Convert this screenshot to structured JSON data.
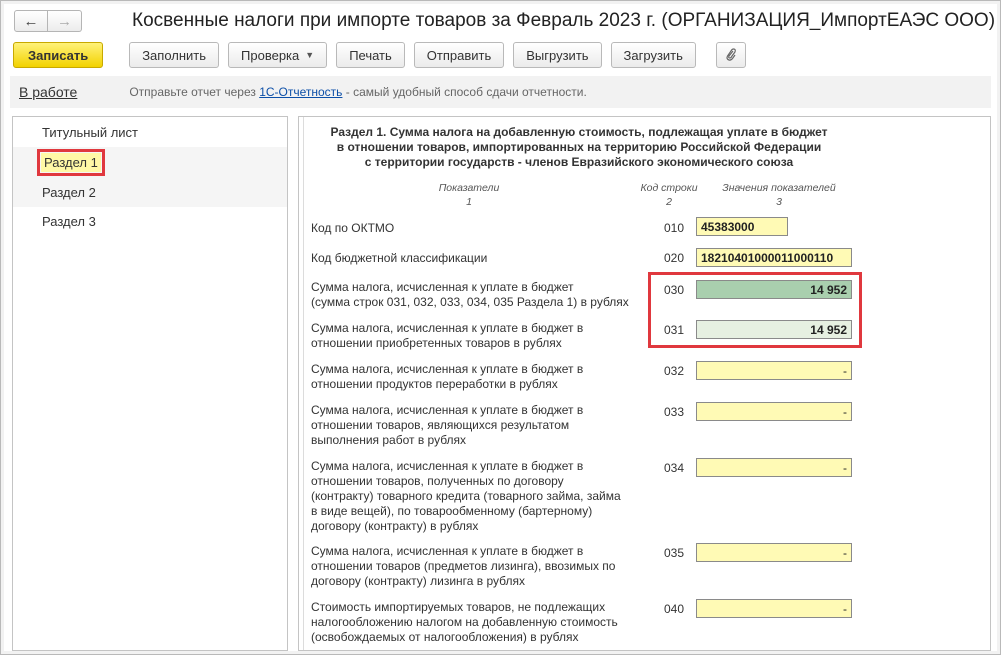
{
  "window": {
    "title": "Косвенные налоги при импорте товаров за Февраль 2023 г. (ОРГАНИЗАЦИЯ_ИмпортЕАЭС ООО)",
    "back_icon": "arrow-left-icon",
    "forward_icon": "arrow-right-icon"
  },
  "toolbar": {
    "save_label": "Записать",
    "fill_label": "Заполнить",
    "check_label": "Проверка",
    "print_label": "Печать",
    "send_label": "Отправить",
    "export_label": "Выгрузить",
    "import_label": "Загрузить",
    "attach_icon": "paperclip-icon"
  },
  "status": {
    "state_label": "В работе",
    "message_before": "Отправьте отчет через ",
    "message_link": "1С-Отчетность",
    "message_after": " - самый удобный способ сдачи отчетности."
  },
  "sidebar": {
    "items": [
      {
        "label": "Титульный лист"
      },
      {
        "label": "Раздел 1"
      },
      {
        "label": "Раздел 2"
      },
      {
        "label": "Раздел 3"
      }
    ]
  },
  "section": {
    "heading_line1": "Раздел 1. Сумма налога на добавленную стоимость, подлежащая уплате в бюджет",
    "heading_line2": "в отношении товаров, импортированных на территорию Российской Федерации",
    "heading_line3": "с территории государств - членов Евразийского экономического союза",
    "col1_title": "Показатели",
    "col1_num": "1",
    "col2_title": "Код строки",
    "col2_num": "2",
    "col3_title": "Значения показателей",
    "col3_num": "3",
    "rows": [
      {
        "label": "Код по ОКТМО",
        "code": "010",
        "value": "45383000"
      },
      {
        "label": "Код бюджетной классификации",
        "code": "020",
        "value": "18210401000011000110"
      },
      {
        "label1": "Сумма налога, исчисленная к уплате в бюджет",
        "label2": "(сумма строк 031, 032, 033, 034, 035 Раздела 1) в рублях",
        "code": "030",
        "value": "14 952"
      },
      {
        "label1": "Сумма налога, исчисленная к уплате в бюджет в",
        "label2": "отношении приобретенных товаров в рублях",
        "code": "031",
        "value": "14 952"
      },
      {
        "label1": "Сумма налога, исчисленная к уплате в бюджет в",
        "label2": "отношении продуктов переработки в рублях",
        "code": "032",
        "value": "-"
      },
      {
        "label1": "Сумма налога, исчисленная к уплате в бюджет в",
        "label2": "отношении товаров, являющихся результатом",
        "label3": "выполнения работ в рублях",
        "code": "033",
        "value": "-"
      },
      {
        "label1": "Сумма налога, исчисленная к уплате в бюджет в",
        "label2": "отношении товаров, полученных по договору",
        "label3": "(контракту) товарного кредита (товарного займа, займа",
        "label4": "в виде вещей), по товарообменному (бартерному)",
        "label5": "договору (контракту) в рублях",
        "code": "034",
        "value": "-"
      },
      {
        "label1": "Сумма налога, исчисленная к уплате в бюджет в",
        "label2": "отношении товаров (предметов лизинга), ввозимых по",
        "label3": "договору (контракту) лизинга в рублях",
        "code": "035",
        "value": "-"
      },
      {
        "label1": "Стоимость импортируемых товаров, не подлежащих",
        "label2": "налогообложению налогом на добавленную стоимость",
        "label3": "(освобождаемых от налогообложения) в рублях",
        "code": "040",
        "value": "-"
      }
    ]
  },
  "colors": {
    "primary_button": "#f2d200",
    "field_yellow": "#fffab5",
    "field_green_dark": "#a9cfae",
    "field_green_light": "#e6f0e1",
    "highlight_red": "#e0383e",
    "link_blue": "#0c4fa8"
  }
}
